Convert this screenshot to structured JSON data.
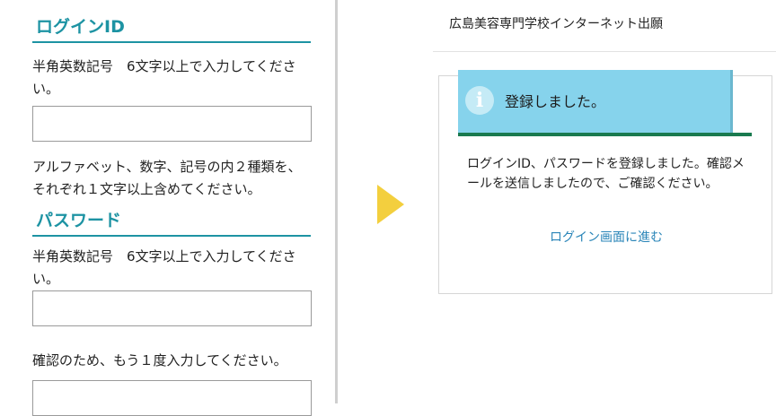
{
  "left": {
    "login_id": {
      "heading": "ログインID",
      "instruction": "半角英数記号　6文字以上で入力してください。",
      "note": "アルファベット、数字、記号の内２種類を、それぞれ１文字以上含めてください。"
    },
    "password": {
      "heading": "パスワード",
      "instruction": "半角英数記号　6文字以上で入力してください。",
      "confirm_instruction": "確認のため、もう１度入力してください。"
    }
  },
  "right": {
    "site_title": "広島美容専門学校インターネット出願",
    "toast": {
      "icon": "info-icon",
      "text": "登録しました。"
    },
    "message": "ログインID、パスワードを登録しました。確認メールを送信しましたので、ご確認ください。",
    "link_label": "ログイン画面に進む"
  },
  "colors": {
    "heading_accent": "#1d93a3",
    "toast_bg": "#86d3ec",
    "toast_bar": "#1a7a4f",
    "arrow": "#f3cf3e",
    "link": "#2a85b8"
  }
}
